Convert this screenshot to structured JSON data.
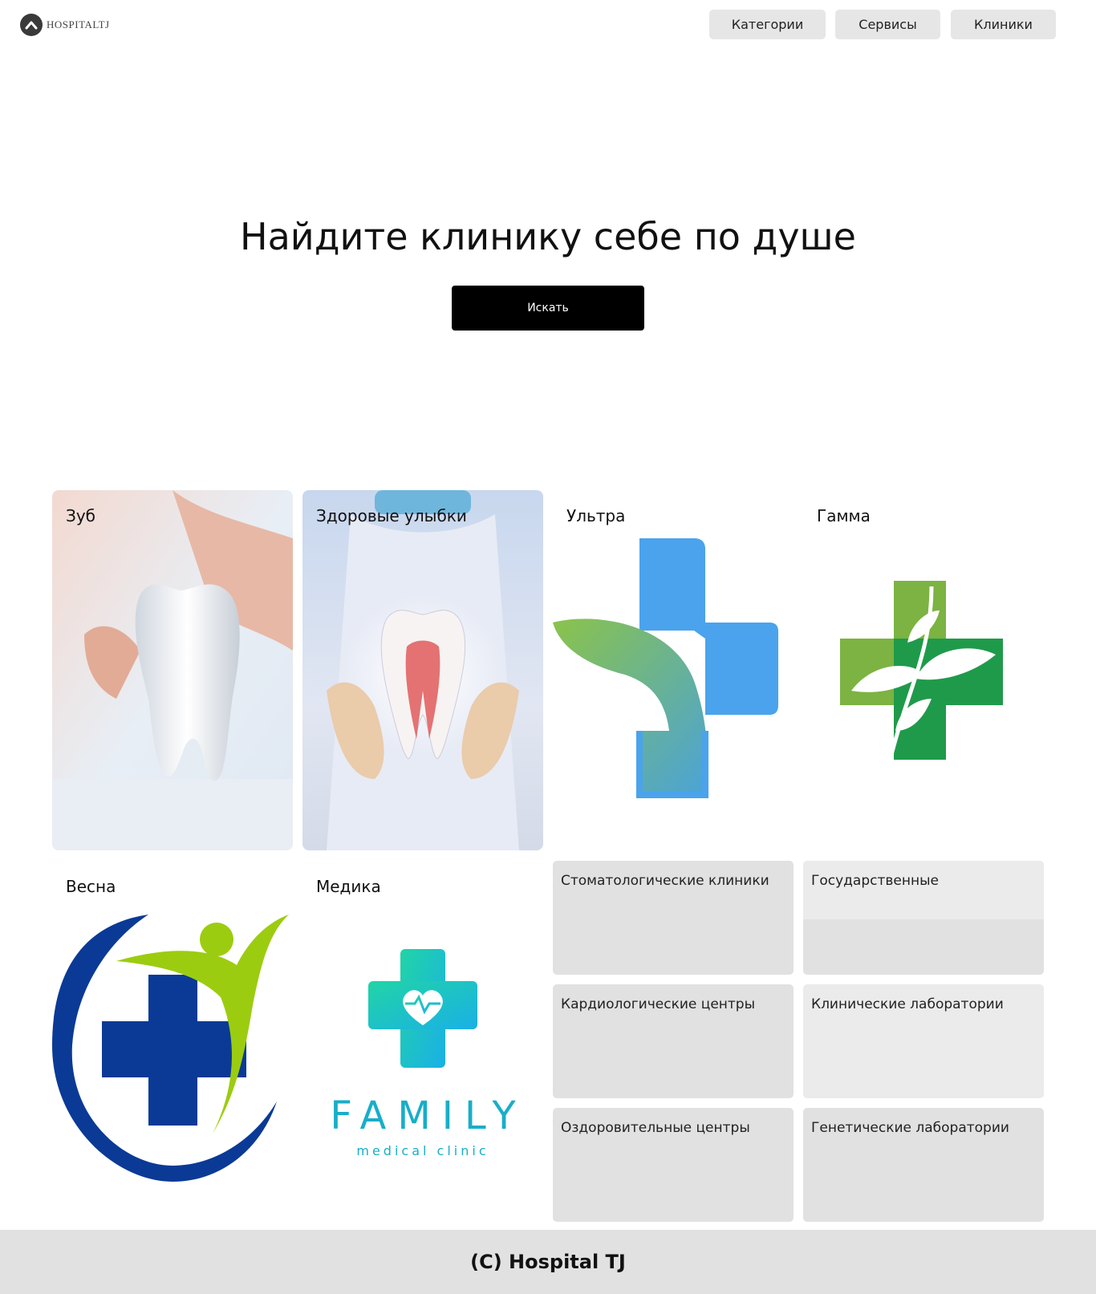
{
  "header": {
    "logo_text": "HOSPITALTJ",
    "nav": [
      "Категории",
      "Сервисы",
      "Клиники"
    ]
  },
  "hero": {
    "title": "Найдите клинику себе по душе",
    "search_label": "Искать"
  },
  "clinics": [
    {
      "name": "Зуб",
      "icon": "tooth-photo"
    },
    {
      "name": "Здоровые улыбки",
      "icon": "tooth-in-hands-photo"
    },
    {
      "name": "Ультра",
      "icon": "blue-cross-leaf-logo"
    },
    {
      "name": "Гамма",
      "icon": "green-cross-leaves-logo"
    },
    {
      "name": "Весна",
      "icon": "blue-cross-figure-logo"
    },
    {
      "name": "Медика",
      "icon": "family-cross-heart-logo",
      "logo_text": "FAMILY",
      "logo_subtext": "medical clinic"
    }
  ],
  "categories": [
    "Стоматологические клиники",
    "Государственные",
    "Кардиологические центры",
    "Клинические лаборатории",
    "Оздоровительные центры",
    "Генетические лаборатории"
  ],
  "footer": {
    "copyright": "(C) Hospital TJ"
  },
  "colors": {
    "nav_bg": "#e6e6e6",
    "search_bg": "#000000",
    "tile_bg": "#e1e1e1",
    "footer_bg": "#e1e1e1"
  }
}
